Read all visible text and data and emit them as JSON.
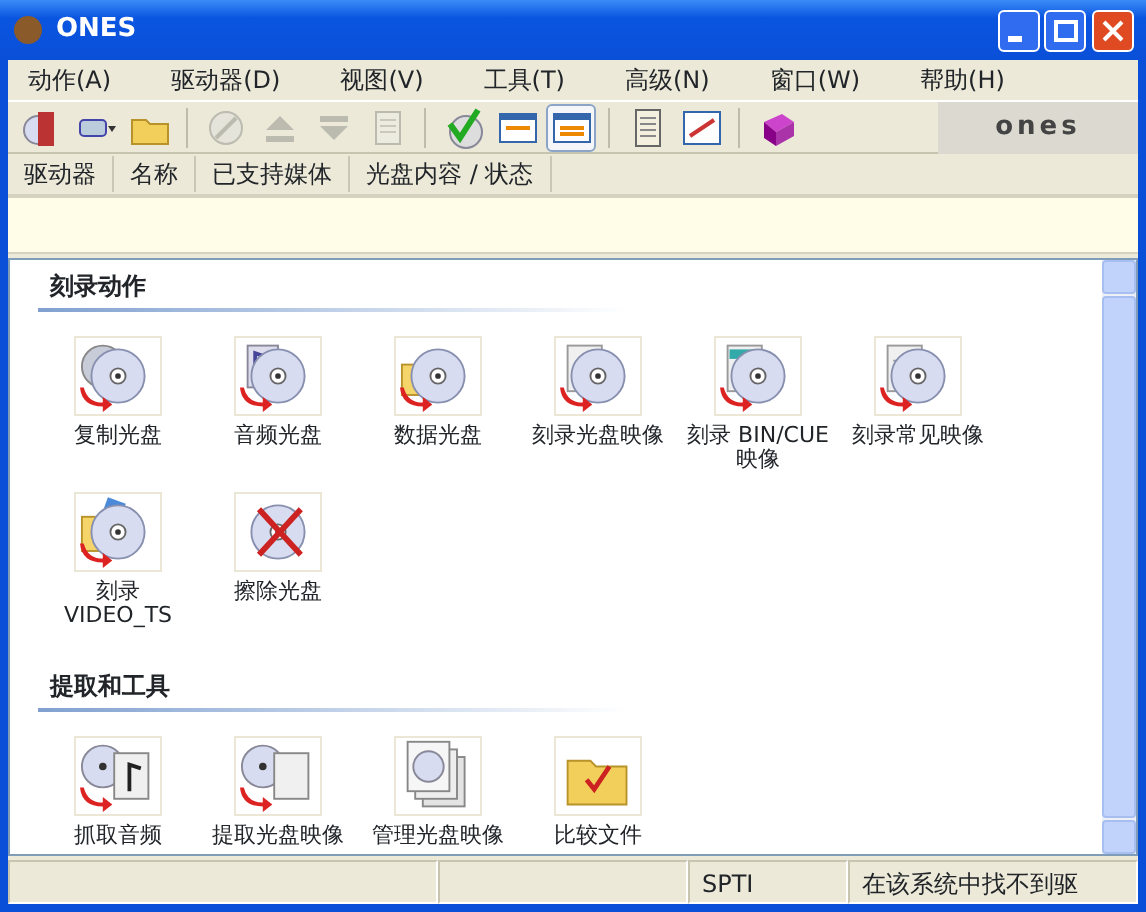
{
  "window": {
    "title": "ONES"
  },
  "menu": [
    "动作(A)",
    "驱动器(D)",
    "视图(V)",
    "工具(T)",
    "高级(N)",
    "窗口(W)",
    "帮助(H)"
  ],
  "toolbar": {
    "buttons": [
      {
        "disabled": false,
        "pressed": false
      },
      {
        "disabled": false,
        "pressed": false
      },
      {
        "disabled": false,
        "pressed": false
      },
      {
        "disabled": true,
        "pressed": false
      },
      {
        "disabled": true,
        "pressed": false
      },
      {
        "disabled": true,
        "pressed": false
      },
      {
        "disabled": true,
        "pressed": false
      },
      {
        "disabled": false,
        "pressed": false
      },
      {
        "disabled": false,
        "pressed": false
      },
      {
        "disabled": false,
        "pressed": true
      },
      {
        "disabled": false,
        "pressed": false
      },
      {
        "disabled": false,
        "pressed": false
      },
      {
        "disabled": false,
        "pressed": false
      }
    ],
    "logo": "ones"
  },
  "columns": [
    "驱动器",
    "名称",
    "已支持媒体",
    "光盘内容 / 状态"
  ],
  "sections": [
    {
      "title": "刻录动作",
      "items": [
        {
          "label": "复制光盘"
        },
        {
          "label": "音频光盘"
        },
        {
          "label": "数据光盘"
        },
        {
          "label": "刻录光盘映像"
        },
        {
          "label": "刻录 BIN/CUE\n映像"
        },
        {
          "label": "刻录常见映像"
        },
        {
          "label": "刻录\nVIDEO_TS"
        },
        {
          "label": "擦除光盘"
        }
      ]
    },
    {
      "title": "提取和工具",
      "items": [
        {
          "label": "抓取音频"
        },
        {
          "label": "提取光盘映像"
        },
        {
          "label": "管理光盘映像"
        },
        {
          "label": "比较文件"
        }
      ]
    }
  ],
  "status_bar": [
    "SPTI",
    "在该系统中找不到驱"
  ]
}
